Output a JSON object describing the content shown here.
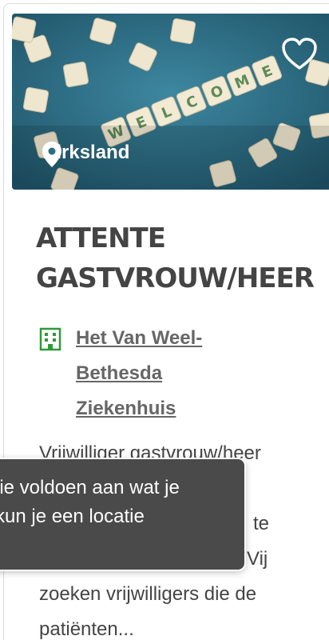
{
  "card": {
    "location": "Dirksland",
    "title_line1": "ATTENTE",
    "title_line2": "GASTVROUW/HEER",
    "organization_line1": "Het Van Weel-",
    "organization_line2": "Bethesda",
    "organization_line3": "Ziekenhuis",
    "description_lines": [
      "Vrijwilliger gastvrouw/heer",
      "",
      "te",
      "Vij",
      "zoeken vrijwilligers die de",
      "patiënten..."
    ],
    "hero_tiles": [
      "W",
      "E",
      "L",
      "C",
      "O",
      "M",
      "E"
    ]
  },
  "tooltip": {
    "line1": "lie voldoen aan wat je",
    "line2": "kun je een locatie"
  },
  "icons": {
    "favorite": "heart-outline-icon",
    "location": "map-pin-icon",
    "organization": "building-icon"
  },
  "colors": {
    "hero_bg": "#2b6f86",
    "org_icon": "#2e9a3a",
    "tooltip_bg": "#4a4a4a",
    "title": "#444444"
  }
}
